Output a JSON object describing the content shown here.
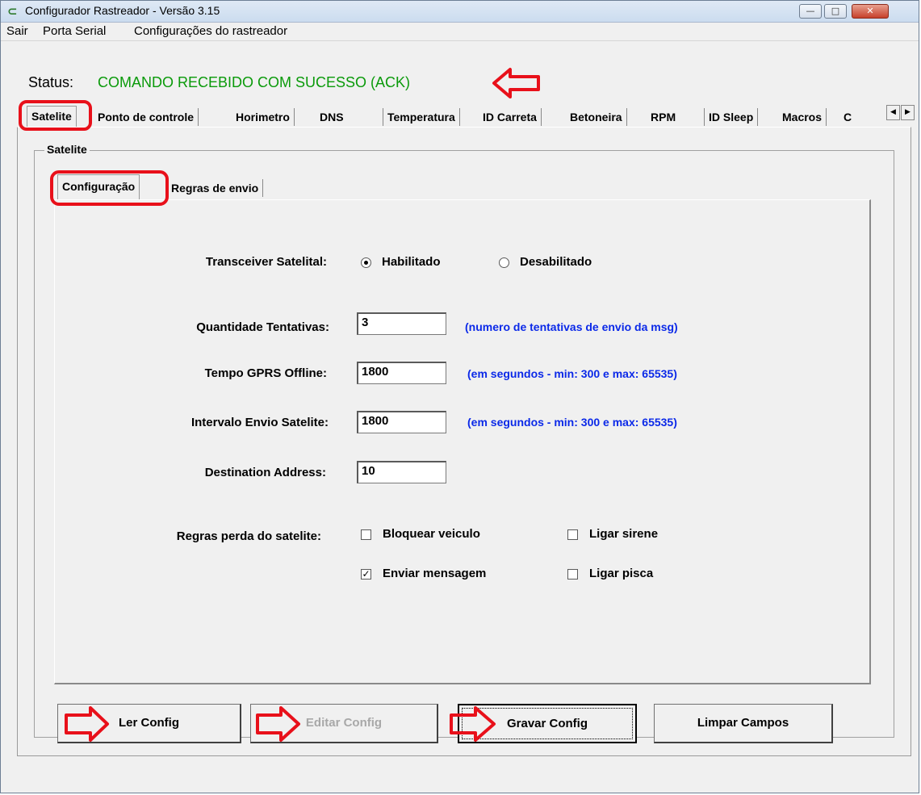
{
  "window": {
    "title": "Configurador Rastreador - Versão 3.15",
    "icon": "c-logo-icon",
    "controls": [
      "minimize",
      "maximize",
      "close"
    ]
  },
  "menu": {
    "items": [
      {
        "label": "Sair"
      },
      {
        "label": "Porta Serial"
      },
      {
        "label": "Configurações do rastreador"
      }
    ]
  },
  "status": {
    "label": "Status:",
    "value": "COMANDO RECEBIDO COM SUCESSO (ACK)",
    "color": "#0a9a0a"
  },
  "tabs": [
    {
      "label": "Satelite",
      "active": true
    },
    {
      "label": "Ponto de controle"
    },
    {
      "label": "Horimetro"
    },
    {
      "label": "DNS"
    },
    {
      "label": "Temperatura"
    },
    {
      "label": "ID Carreta"
    },
    {
      "label": "Betoneira"
    },
    {
      "label": "RPM"
    },
    {
      "label": "ID Sleep"
    },
    {
      "label": "Macros"
    },
    {
      "label": "C"
    }
  ],
  "group": {
    "title": "Satelite"
  },
  "subtabs": [
    {
      "label": "Configuração",
      "active": true
    },
    {
      "label": "Regras de envio"
    }
  ],
  "form": {
    "transceiver": {
      "label": "Transceiver Satelital:",
      "options": [
        {
          "label": "Habilitado",
          "selected": true
        },
        {
          "label": "Desabilitado",
          "selected": false
        }
      ]
    },
    "tentativas": {
      "label": "Quantidade Tentativas:",
      "value": "3",
      "hint": "(numero de tentativas de envio da msg)"
    },
    "gprs_offline": {
      "label": "Tempo GPRS Offline:",
      "value": "1800",
      "hint": "(em segundos - min: 300 e max: 65535)"
    },
    "intervalo": {
      "label": "Intervalo Envio Satelite:",
      "value": "1800",
      "hint": "(em segundos - min: 300 e max: 65535)"
    },
    "destination": {
      "label": "Destination Address:",
      "value": "10"
    },
    "regras": {
      "label": "Regras perda do satelite:",
      "options": [
        {
          "label": "Bloquear veiculo",
          "checked": false
        },
        {
          "label": "Ligar sirene",
          "checked": false
        },
        {
          "label": "Enviar mensagem",
          "checked": true
        },
        {
          "label": "Ligar pisca",
          "checked": false
        }
      ]
    },
    "hint_color": "#0b29e8"
  },
  "buttons": {
    "ler": "Ler Config",
    "editar": "Editar Config",
    "gravar": "Gravar Config",
    "limpar": "Limpar Campos"
  },
  "annotation_color": "#e8101a"
}
